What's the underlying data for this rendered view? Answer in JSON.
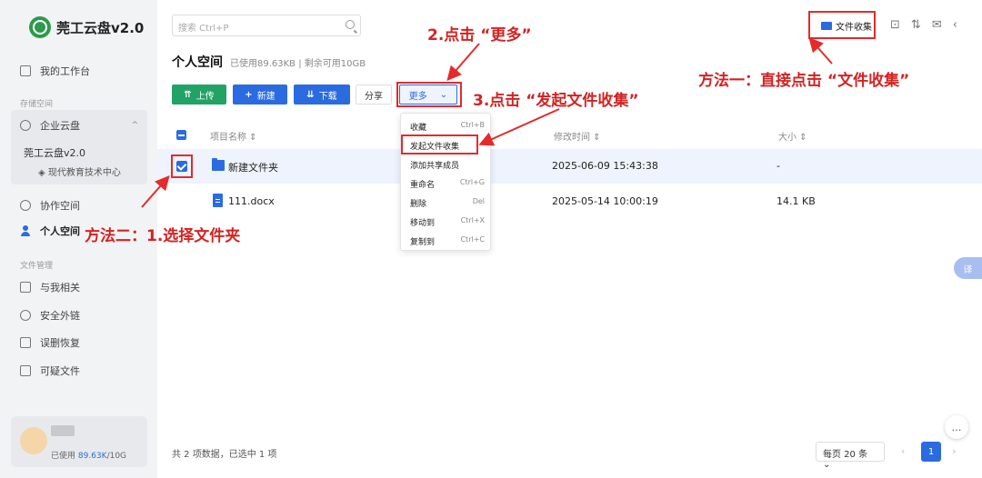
{
  "app": {
    "logo_text": "莞工云盘v2.0"
  },
  "sidebar": {
    "workbench": "我的工作台",
    "storage_section": "存储空间",
    "enterprise": "企业云盘",
    "enterprise_sub1": "莞工云盘v2.0",
    "enterprise_sub2": "现代教育技术中心",
    "collab": "协作空间",
    "personal": "个人空间",
    "file_mgmt_section": "文件管理",
    "related": "与我相关",
    "secure_link": "安全外链",
    "recycle": "误删恢复",
    "suspicious": "可疑文件",
    "storage_label": "已使用",
    "storage_used": "89.63K",
    "storage_total": "/10G"
  },
  "header": {
    "search_placeholder": "搜索 Ctrl+P",
    "file_collect": "文件收集",
    "page_title": "个人空间",
    "usage": "已使用89.63KB | 剩余可用10GB"
  },
  "toolbar": {
    "upload": "上传",
    "new": "新建",
    "download": "下载",
    "share": "分享",
    "more": "更多"
  },
  "table": {
    "headers": {
      "name": "项目名称",
      "modified": "修改时间",
      "size": "大小"
    },
    "rows": [
      {
        "name": "新建文件夹",
        "modified": "2025-06-09 15:43:38",
        "size": "-"
      },
      {
        "name": "111.docx",
        "modified": "2025-05-14 10:00:19",
        "size": "14.1 KB"
      }
    ]
  },
  "more_menu": [
    {
      "label": "收藏",
      "shortcut": "Ctrl+B"
    },
    {
      "label": "发起文件收集",
      "shortcut": ""
    },
    {
      "label": "添加共享成员",
      "shortcut": ""
    },
    {
      "label": "重命名",
      "shortcut": "Ctrl+G"
    },
    {
      "label": "删除",
      "shortcut": "Del"
    },
    {
      "label": "移动到",
      "shortcut": "Ctrl+X"
    },
    {
      "label": "复制到",
      "shortcut": "Ctrl+C"
    }
  ],
  "footer": {
    "count": "共 2 项数据，已选中 1 项",
    "page_size": "每页 20 条",
    "page": "1"
  },
  "translate_fab": "译",
  "annotations": {
    "step_more": "2.点击 “更多”",
    "step_collect": "3.点击 “发起文件收集”",
    "method_one": "方法一：直接点击 “文件收集”",
    "method_two": "方法二：1.选择文件夹"
  },
  "colors": {
    "accent": "#2a6be0",
    "upload": "#21a366",
    "annotation": "#e32b2b"
  }
}
